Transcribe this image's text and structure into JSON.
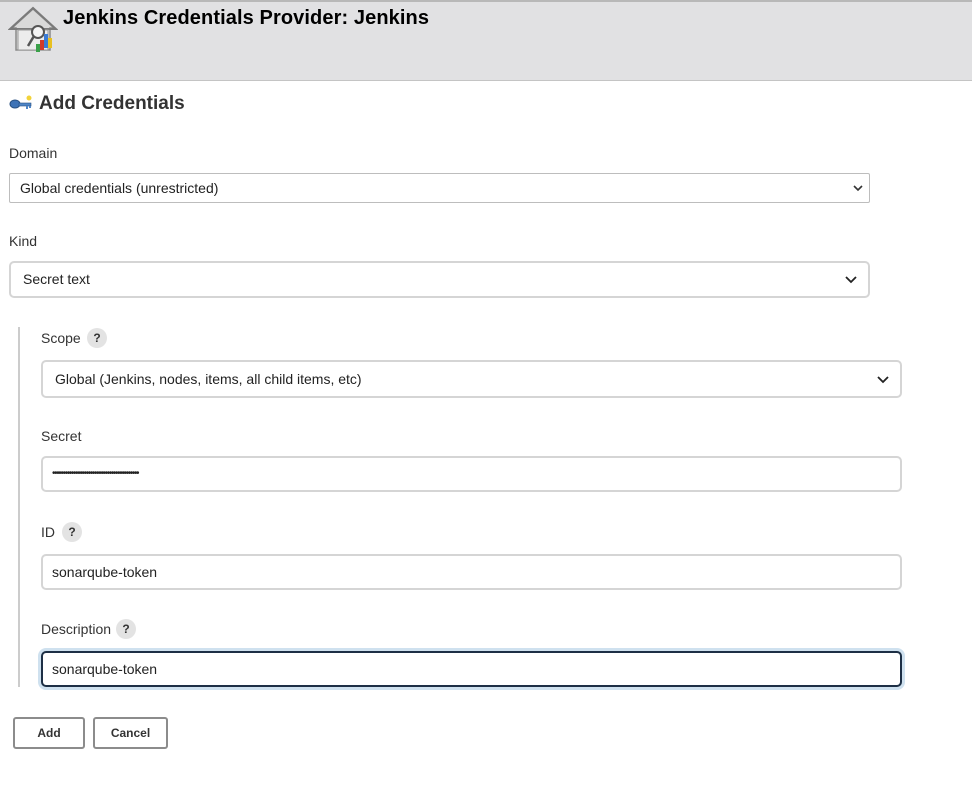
{
  "header": {
    "title": "Jenkins Credentials Provider: Jenkins",
    "icon": "credentials-house-icon"
  },
  "section": {
    "title": "Add Credentials",
    "icon": "key-icon"
  },
  "form": {
    "domain": {
      "label": "Domain",
      "selected": "Global credentials (unrestricted)"
    },
    "kind": {
      "label": "Kind",
      "selected": "Secret text"
    },
    "scope": {
      "label": "Scope",
      "help": "?",
      "selected": "Global (Jenkins, nodes, items, all child items, etc)"
    },
    "secret": {
      "label": "Secret",
      "value": "•••••••••••••••••••••••••••••••••••••••••"
    },
    "id": {
      "label": "ID",
      "help": "?",
      "value": "sonarqube-token"
    },
    "description": {
      "label": "Description",
      "help": "?",
      "value": "sonarqube-token"
    }
  },
  "buttons": {
    "add": "Add",
    "cancel": "Cancel"
  },
  "colors": {
    "header_bg": "#e1e1e3",
    "focus_border": "#1d2f45",
    "focus_ring": "#cfe1ef"
  }
}
